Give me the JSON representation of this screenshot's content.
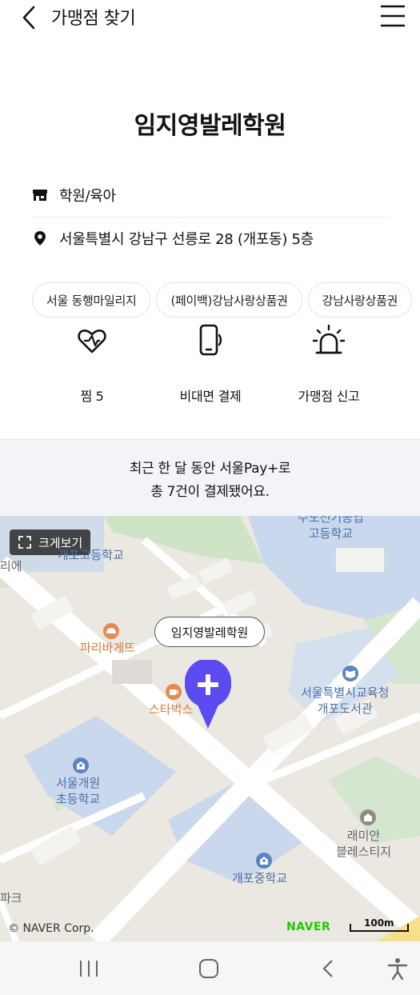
{
  "header": {
    "title": "가맹점 찾기"
  },
  "store": {
    "name": "임지영발레학원",
    "category": "학원/육아",
    "address": "서울특별시 강남구 선릉로 28 (개포동) 5층"
  },
  "chips": [
    "서울 동행마일리지",
    "(페이백)강남사랑상품권",
    "강남사랑상품권"
  ],
  "actions": {
    "like_label": "찜 5",
    "noncontact_label": "비대면 결제",
    "report_label": "가맹점 신고"
  },
  "banner": {
    "line1": "최근 한 달 동안 서울Pay+로",
    "line2": "총 7건이 결제됐어요."
  },
  "map": {
    "expand_label": "크게보기",
    "callout": "임지영발레학원",
    "labels": {
      "school_top_right": "수도전기공업\n고등학교",
      "school_top_left": "개포고등학교",
      "left_partial": "리에",
      "paris": "파리바게뜨",
      "starbucks": "스타벅스",
      "library": "서울특별시교육청\n개포도서관",
      "elementary": "서울개원\n초등학교",
      "apartment": "래미안\n블레스티지",
      "middle_school": "개포중학교",
      "park_partial": "파크"
    },
    "copyright": "© NAVER Corp.",
    "naver": "NAVER",
    "scale": "100m",
    "colors": {
      "pin": "#5a4cf0",
      "school": "#4a6fa5",
      "food": "#d9793a"
    }
  }
}
